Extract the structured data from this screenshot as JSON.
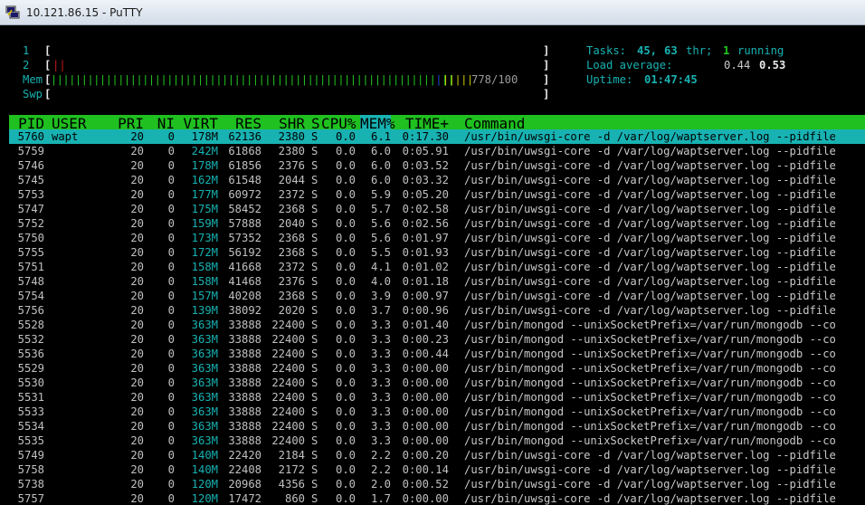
{
  "window": {
    "title": "10.121.86.15 - PuTTY"
  },
  "meters": {
    "cpu1": {
      "label": "1",
      "open": "[",
      "close": "]"
    },
    "cpu2": {
      "label": "2",
      "open": "[",
      "bars": "||",
      "close": "]"
    },
    "mem": {
      "label": "Mem",
      "open": "[",
      "bars_green": "||||||||||||||||||||||||||||||||||||||||||||||||||||||||||||||||||",
      "bars_blue": "|",
      "bars_yellow": "|||||",
      "value": "778/100",
      "close": "]"
    },
    "swp": {
      "label": "Swp",
      "open": "[",
      "close": "]"
    }
  },
  "summary": {
    "tasks_label": "Tasks:",
    "tasks": "45,",
    "thr": "63",
    "thr_label": "thr;",
    "running": "1",
    "running_label": "running",
    "load_label": "Load average:",
    "load1": "0.44",
    "load5": "0.53",
    "uptime_label": "Uptime:",
    "uptime": "01:47:45"
  },
  "columns": [
    "PID",
    "USER",
    "PRI",
    "NI",
    "VIRT",
    "RES",
    "SHR",
    "S",
    "CPU%",
    "MEM%",
    "TIME+",
    "Command"
  ],
  "processes": [
    {
      "pid": "5760",
      "user": "wapt",
      "pri": "20",
      "ni": "0",
      "virt": "178M",
      "res": "62136",
      "shr": "2380",
      "s": "S",
      "cpu": "0.0",
      "mem": "6.1",
      "time": "0:17.30",
      "cmd": "/usr/bin/uwsgi-core -d /var/log/waptserver.log --pidfile"
    },
    {
      "pid": "5759",
      "user": "",
      "pri": "20",
      "ni": "0",
      "virt": "242M",
      "res": "61868",
      "shr": "2380",
      "s": "S",
      "cpu": "0.0",
      "mem": "6.0",
      "time": "0:05.91",
      "cmd": "/usr/bin/uwsgi-core -d /var/log/waptserver.log --pidfile"
    },
    {
      "pid": "5746",
      "user": "",
      "pri": "20",
      "ni": "0",
      "virt": "178M",
      "res": "61856",
      "shr": "2376",
      "s": "S",
      "cpu": "0.0",
      "mem": "6.0",
      "time": "0:03.52",
      "cmd": "/usr/bin/uwsgi-core -d /var/log/waptserver.log --pidfile"
    },
    {
      "pid": "5745",
      "user": "",
      "pri": "20",
      "ni": "0",
      "virt": "162M",
      "res": "61548",
      "shr": "2044",
      "s": "S",
      "cpu": "0.0",
      "mem": "6.0",
      "time": "0:03.32",
      "cmd": "/usr/bin/uwsgi-core -d /var/log/waptserver.log --pidfile"
    },
    {
      "pid": "5753",
      "user": "",
      "pri": "20",
      "ni": "0",
      "virt": "177M",
      "res": "60972",
      "shr": "2372",
      "s": "S",
      "cpu": "0.0",
      "mem": "5.9",
      "time": "0:05.20",
      "cmd": "/usr/bin/uwsgi-core -d /var/log/waptserver.log --pidfile"
    },
    {
      "pid": "5747",
      "user": "",
      "pri": "20",
      "ni": "0",
      "virt": "175M",
      "res": "58452",
      "shr": "2368",
      "s": "S",
      "cpu": "0.0",
      "mem": "5.7",
      "time": "0:02.58",
      "cmd": "/usr/bin/uwsgi-core -d /var/log/waptserver.log --pidfile"
    },
    {
      "pid": "5752",
      "user": "",
      "pri": "20",
      "ni": "0",
      "virt": "159M",
      "res": "57888",
      "shr": "2040",
      "s": "S",
      "cpu": "0.0",
      "mem": "5.6",
      "time": "0:02.56",
      "cmd": "/usr/bin/uwsgi-core -d /var/log/waptserver.log --pidfile"
    },
    {
      "pid": "5750",
      "user": "",
      "pri": "20",
      "ni": "0",
      "virt": "173M",
      "res": "57352",
      "shr": "2368",
      "s": "S",
      "cpu": "0.0",
      "mem": "5.6",
      "time": "0:01.97",
      "cmd": "/usr/bin/uwsgi-core -d /var/log/waptserver.log --pidfile"
    },
    {
      "pid": "5755",
      "user": "",
      "pri": "20",
      "ni": "0",
      "virt": "172M",
      "res": "56192",
      "shr": "2368",
      "s": "S",
      "cpu": "0.0",
      "mem": "5.5",
      "time": "0:01.93",
      "cmd": "/usr/bin/uwsgi-core -d /var/log/waptserver.log --pidfile"
    },
    {
      "pid": "5751",
      "user": "",
      "pri": "20",
      "ni": "0",
      "virt": "158M",
      "res": "41668",
      "shr": "2372",
      "s": "S",
      "cpu": "0.0",
      "mem": "4.1",
      "time": "0:01.02",
      "cmd": "/usr/bin/uwsgi-core -d /var/log/waptserver.log --pidfile"
    },
    {
      "pid": "5748",
      "user": "",
      "pri": "20",
      "ni": "0",
      "virt": "158M",
      "res": "41468",
      "shr": "2376",
      "s": "S",
      "cpu": "0.0",
      "mem": "4.0",
      "time": "0:01.18",
      "cmd": "/usr/bin/uwsgi-core -d /var/log/waptserver.log --pidfile"
    },
    {
      "pid": "5754",
      "user": "",
      "pri": "20",
      "ni": "0",
      "virt": "157M",
      "res": "40208",
      "shr": "2368",
      "s": "S",
      "cpu": "0.0",
      "mem": "3.9",
      "time": "0:00.97",
      "cmd": "/usr/bin/uwsgi-core -d /var/log/waptserver.log --pidfile"
    },
    {
      "pid": "5756",
      "user": "",
      "pri": "20",
      "ni": "0",
      "virt": "139M",
      "res": "38092",
      "shr": "2020",
      "s": "S",
      "cpu": "0.0",
      "mem": "3.7",
      "time": "0:00.96",
      "cmd": "/usr/bin/uwsgi-core -d /var/log/waptserver.log --pidfile"
    },
    {
      "pid": "5528",
      "user": "",
      "pri": "20",
      "ni": "0",
      "virt": "363M",
      "res": "33888",
      "shr": "22400",
      "s": "S",
      "cpu": "0.0",
      "mem": "3.3",
      "time": "0:01.40",
      "cmd": "/usr/bin/mongod --unixSocketPrefix=/var/run/mongodb --co"
    },
    {
      "pid": "5532",
      "user": "",
      "pri": "20",
      "ni": "0",
      "virt": "363M",
      "res": "33888",
      "shr": "22400",
      "s": "S",
      "cpu": "0.0",
      "mem": "3.3",
      "time": "0:00.23",
      "cmd": "/usr/bin/mongod --unixSocketPrefix=/var/run/mongodb --co"
    },
    {
      "pid": "5536",
      "user": "",
      "pri": "20",
      "ni": "0",
      "virt": "363M",
      "res": "33888",
      "shr": "22400",
      "s": "S",
      "cpu": "0.0",
      "mem": "3.3",
      "time": "0:00.44",
      "cmd": "/usr/bin/mongod --unixSocketPrefix=/var/run/mongodb --co"
    },
    {
      "pid": "5529",
      "user": "",
      "pri": "20",
      "ni": "0",
      "virt": "363M",
      "res": "33888",
      "shr": "22400",
      "s": "S",
      "cpu": "0.0",
      "mem": "3.3",
      "time": "0:00.00",
      "cmd": "/usr/bin/mongod --unixSocketPrefix=/var/run/mongodb --co"
    },
    {
      "pid": "5530",
      "user": "",
      "pri": "20",
      "ni": "0",
      "virt": "363M",
      "res": "33888",
      "shr": "22400",
      "s": "S",
      "cpu": "0.0",
      "mem": "3.3",
      "time": "0:00.00",
      "cmd": "/usr/bin/mongod --unixSocketPrefix=/var/run/mongodb --co"
    },
    {
      "pid": "5531",
      "user": "",
      "pri": "20",
      "ni": "0",
      "virt": "363M",
      "res": "33888",
      "shr": "22400",
      "s": "S",
      "cpu": "0.0",
      "mem": "3.3",
      "time": "0:00.00",
      "cmd": "/usr/bin/mongod --unixSocketPrefix=/var/run/mongodb --co"
    },
    {
      "pid": "5533",
      "user": "",
      "pri": "20",
      "ni": "0",
      "virt": "363M",
      "res": "33888",
      "shr": "22400",
      "s": "S",
      "cpu": "0.0",
      "mem": "3.3",
      "time": "0:00.00",
      "cmd": "/usr/bin/mongod --unixSocketPrefix=/var/run/mongodb --co"
    },
    {
      "pid": "5534",
      "user": "",
      "pri": "20",
      "ni": "0",
      "virt": "363M",
      "res": "33888",
      "shr": "22400",
      "s": "S",
      "cpu": "0.0",
      "mem": "3.3",
      "time": "0:00.00",
      "cmd": "/usr/bin/mongod --unixSocketPrefix=/var/run/mongodb --co"
    },
    {
      "pid": "5535",
      "user": "",
      "pri": "20",
      "ni": "0",
      "virt": "363M",
      "res": "33888",
      "shr": "22400",
      "s": "S",
      "cpu": "0.0",
      "mem": "3.3",
      "time": "0:00.00",
      "cmd": "/usr/bin/mongod --unixSocketPrefix=/var/run/mongodb --co"
    },
    {
      "pid": "5749",
      "user": "",
      "pri": "20",
      "ni": "0",
      "virt": "140M",
      "res": "22420",
      "shr": "2184",
      "s": "S",
      "cpu": "0.0",
      "mem": "2.2",
      "time": "0:00.20",
      "cmd": "/usr/bin/uwsgi-core -d /var/log/waptserver.log --pidfile"
    },
    {
      "pid": "5758",
      "user": "",
      "pri": "20",
      "ni": "0",
      "virt": "140M",
      "res": "22408",
      "shr": "2172",
      "s": "S",
      "cpu": "0.0",
      "mem": "2.2",
      "time": "0:00.14",
      "cmd": "/usr/bin/uwsgi-core -d /var/log/waptserver.log --pidfile"
    },
    {
      "pid": "5738",
      "user": "",
      "pri": "20",
      "ni": "0",
      "virt": "120M",
      "res": "20968",
      "shr": "4356",
      "s": "S",
      "cpu": "0.0",
      "mem": "2.0",
      "time": "0:00.52",
      "cmd": "/usr/bin/uwsgi-core -d /var/log/waptserver.log --pidfile"
    },
    {
      "pid": "5757",
      "user": "",
      "pri": "20",
      "ni": "0",
      "virt": "120M",
      "res": "17472",
      "shr": "860",
      "s": "S",
      "cpu": "0.0",
      "mem": "1.7",
      "time": "0:00.00",
      "cmd": "/usr/bin/uwsgi-core -d /var/log/waptserver.log --pidfile"
    }
  ]
}
